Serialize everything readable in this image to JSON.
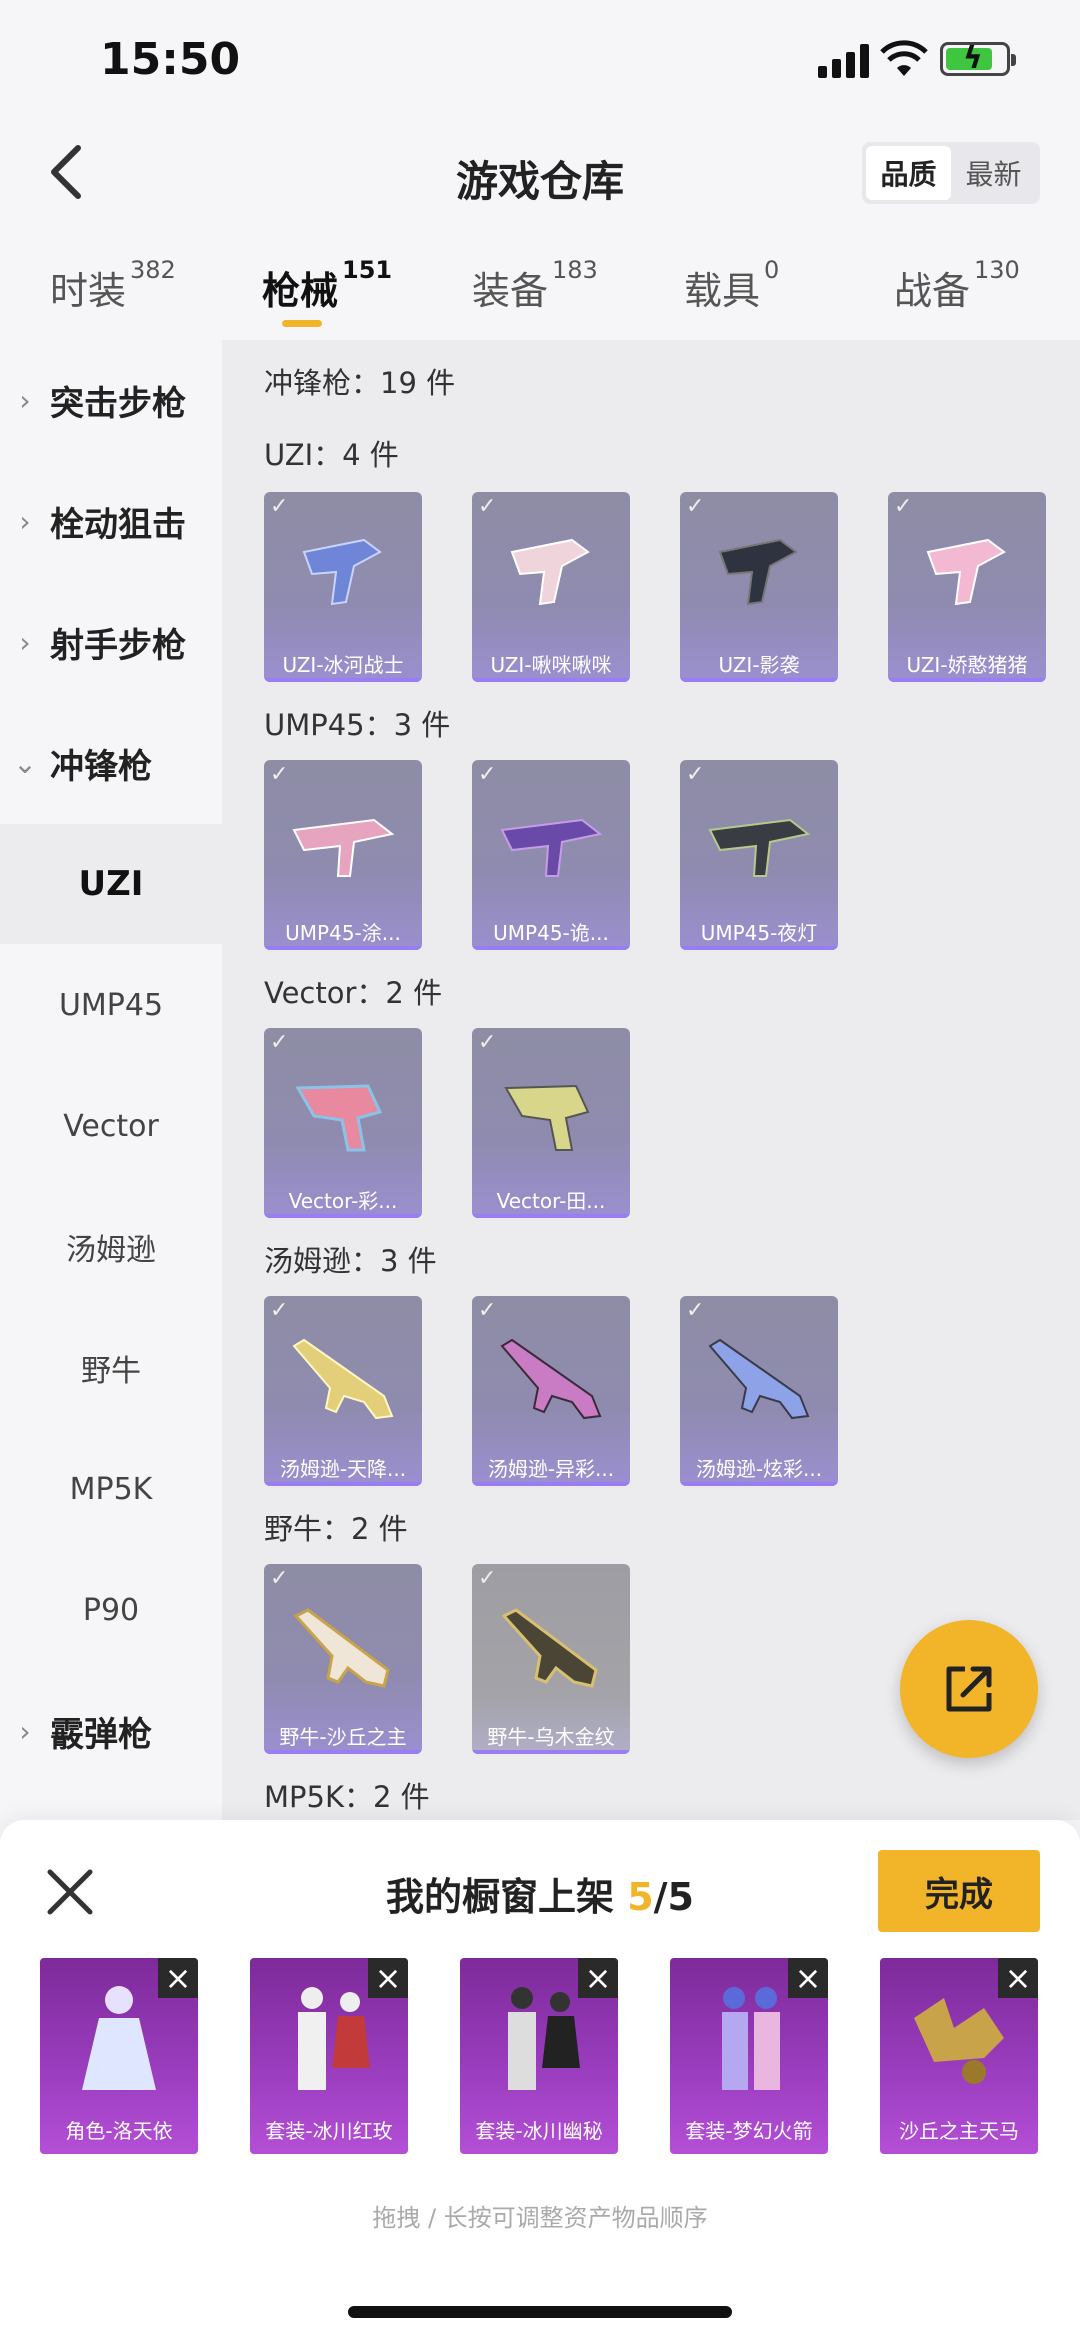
{
  "status_bar": {
    "time": "15:50"
  },
  "header": {
    "title": "游戏仓库",
    "sort_options": [
      "品质",
      "最新"
    ],
    "sort_active": "品质"
  },
  "categories": [
    {
      "label": "时装",
      "count": "382"
    },
    {
      "label": "枪械",
      "count": "151"
    },
    {
      "label": "装备",
      "count": "183"
    },
    {
      "label": "载具",
      "count": "0"
    },
    {
      "label": "战备",
      "count": "130"
    }
  ],
  "active_category": "枪械",
  "sidebar": {
    "groups": [
      {
        "label": "突击步枪"
      },
      {
        "label": "栓动狙击"
      },
      {
        "label": "射手步枪"
      },
      {
        "label": "冲锋枪"
      },
      {
        "label": "霰弹枪"
      }
    ],
    "subitems": [
      "UZI",
      "UMP45",
      "Vector",
      "汤姆逊",
      "野牛",
      "MP5K",
      "P90"
    ],
    "active_sub": "UZI"
  },
  "content": {
    "header": "冲锋枪：19 件",
    "sections": [
      {
        "title": "UZI：4 件",
        "items": [
          "UZI-冰河战士",
          "UZI-啾咪啾咪",
          "UZI-影袭",
          "UZI-娇憨猪猪"
        ]
      },
      {
        "title": "UMP45：3 件",
        "items": [
          "UMP45-涂...",
          "UMP45-诡...",
          "UMP45-夜灯"
        ]
      },
      {
        "title": "Vector：2 件",
        "items": [
          "Vector-彩...",
          "Vector-田..."
        ]
      },
      {
        "title": "汤姆逊：3 件",
        "items": [
          "汤姆逊-天降...",
          "汤姆逊-异彩...",
          "汤姆逊-炫彩..."
        ]
      },
      {
        "title": "野牛：2 件",
        "items": [
          "野牛-沙丘之主",
          "野牛-乌木金纹"
        ]
      },
      {
        "title": "MP5K：2 件",
        "items": []
      }
    ]
  },
  "bottom_panel": {
    "title_prefix": "我的橱窗上架 ",
    "count": "5",
    "total": "/5",
    "done_label": "完成",
    "shelf": [
      "角色-洛天依",
      "套装-冰川红玫",
      "套装-冰川幽秘",
      "套装-梦幻火箭",
      "沙丘之主天马"
    ],
    "hint": "拖拽 / 长按可调整资产物品顺序"
  },
  "colors": {
    "accent": "#f2b52a",
    "card_purple": "#9a7cf5",
    "shelf_purple": "#9c3ec0"
  }
}
